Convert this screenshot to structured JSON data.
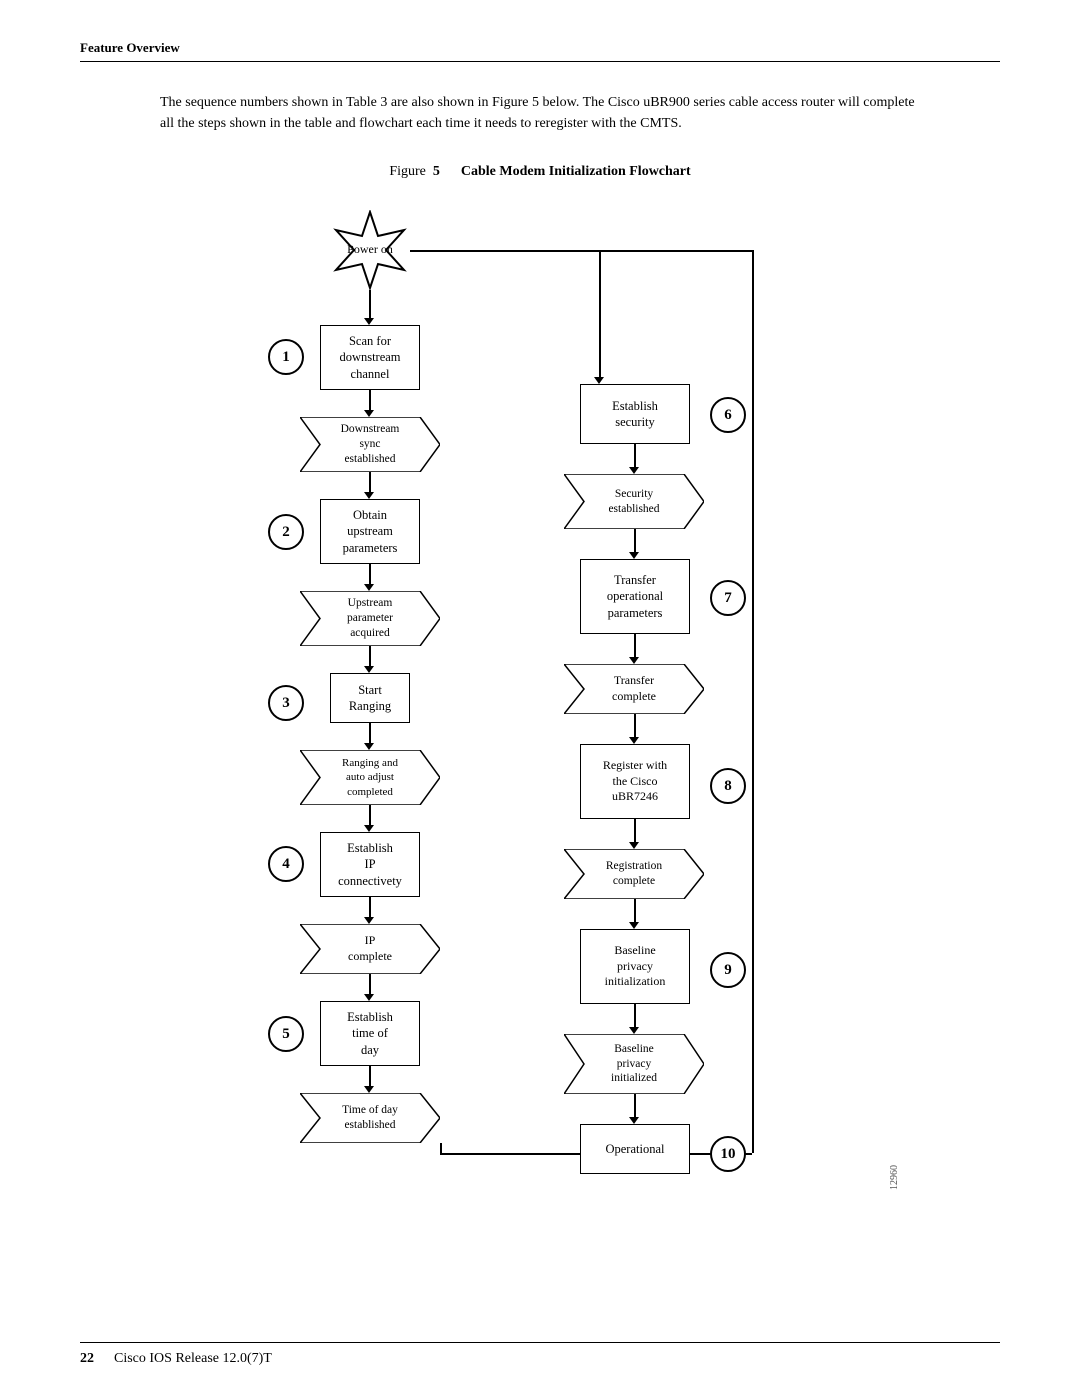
{
  "header": {
    "section": "Feature Overview"
  },
  "intro": {
    "text": "The sequence numbers shown in Table 3 are also shown in Figure 5 below. The Cisco uBR900 series cable access router will complete all the steps shown in the table and flowchart each time it needs to reregister with the CMTS."
  },
  "figure": {
    "label": "Figure",
    "number": "5",
    "title": "Cable Modem Initialization Flowchart"
  },
  "nodes": {
    "power_on": "Power\non",
    "scan_downstream": "Scan for\ndownstream\nchannel",
    "downstream_sync": "Downstream\nsync\nestablished",
    "obtain_upstream": "Obtain\nupstream\nparameters",
    "upstream_acquired": "Upstream\nparameter\nacquired",
    "start_ranging": "Start\nRanging",
    "ranging_complete": "Ranging and\nauto adjust\ncompleted",
    "establish_ip": "Establish\nIP\nconnectivety",
    "ip_complete": "IP\ncomplete",
    "establish_tod": "Establish\ntime of\nday",
    "tod_established": "Time of day\nestablished",
    "establish_security": "Establish\nsecurity",
    "security_established": "Security\nestablished",
    "transfer_op_params": "Transfer\noperational\nparameters",
    "transfer_complete": "Transfer\ncomplete",
    "register_cisco": "Register with\nthe Cisco\nuBR7246",
    "registration_complete": "Registration\ncomplete",
    "baseline_privacy_init": "Baseline\nprivacy\ninitialization",
    "baseline_privacy_initialized": "Baseline\nprivacy\ninitialized",
    "operational": "Operational"
  },
  "numbers": [
    "1",
    "2",
    "3",
    "4",
    "5",
    "6",
    "7",
    "8",
    "9",
    "10"
  ],
  "footer": {
    "page": "22",
    "text": "Cisco IOS Release 12.0(7)T"
  },
  "figure_id": "12960"
}
